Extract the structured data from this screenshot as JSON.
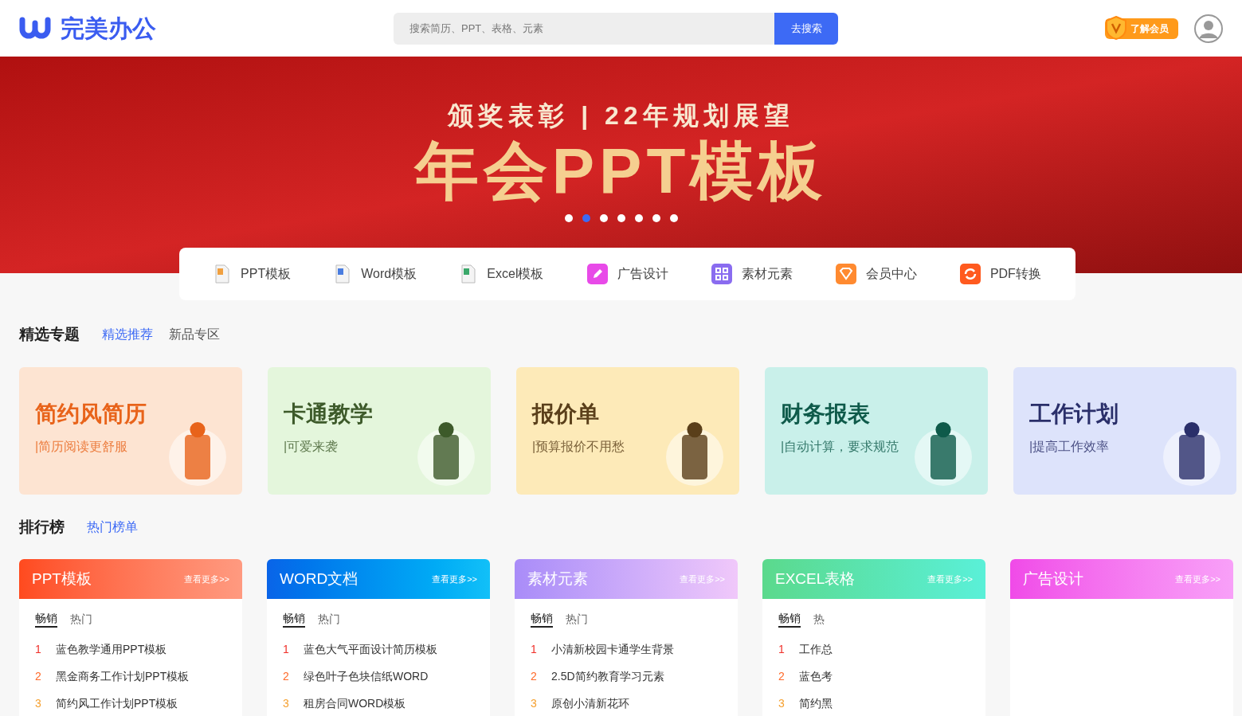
{
  "header": {
    "logo": "完美办公",
    "search": {
      "placeholder": "搜索简历、PPT、表格、元素",
      "button": "去搜索"
    },
    "vip": "了解会员"
  },
  "banner": {
    "subtitle": "颁奖表彰 | 22年规划展望",
    "title": "年会PPT模板",
    "dots": [
      {
        "selected": false
      },
      {
        "selected": true
      },
      {
        "selected": false
      },
      {
        "selected": false
      },
      {
        "selected": false
      },
      {
        "selected": false
      },
      {
        "selected": false
      }
    ]
  },
  "categories": [
    {
      "kind": "ppt",
      "label": "PPT模板"
    },
    {
      "kind": "word",
      "label": "Word模板"
    },
    {
      "kind": "excel",
      "label": "Excel模板"
    },
    {
      "kind": "ad",
      "label": "广告设计"
    },
    {
      "kind": "material",
      "label": "素材元素"
    },
    {
      "kind": "vip",
      "label": "会员中心"
    },
    {
      "kind": "pdf",
      "label": "PDF转换"
    }
  ],
  "featured": {
    "title": "精选专题",
    "tabs": [
      {
        "label": "精选推荐",
        "selected": true
      },
      {
        "label": "新品专区",
        "selected": false
      }
    ],
    "cards": [
      {
        "title": "简约风简历",
        "subtitle": "|简历阅读更舒服",
        "color": "#e8631a"
      },
      {
        "title": "卡通教学",
        "subtitle": "|可爱来袭",
        "color": "#3d5a2a"
      },
      {
        "title": "报价单",
        "subtitle": "|预算报价不用愁",
        "color": "#5a3f1a"
      },
      {
        "title": "财务报表",
        "subtitle": "|自动计算，要求规范",
        "color": "#0e5a4a"
      },
      {
        "title": "工作计划",
        "subtitle": "|提高工作效率",
        "color": "#2a2f6a"
      }
    ]
  },
  "ranking": {
    "title": "排行榜",
    "tabs": [
      {
        "label": "热门榜单",
        "selected": true
      }
    ],
    "boards": [
      {
        "title": "PPT模板",
        "more": "查看更多>>",
        "tabs": [
          {
            "label": "畅销",
            "selected": true
          },
          {
            "label": "热门",
            "selected": false
          }
        ],
        "items": [
          {
            "rank": "1",
            "name": "蓝色教学通用PPT模板"
          },
          {
            "rank": "2",
            "name": "黑金商务工作计划PPT模板"
          },
          {
            "rank": "3",
            "name": "简约风工作计划PPT模板"
          }
        ]
      },
      {
        "title": "WORD文档",
        "more": "查看更多>>",
        "tabs": [
          {
            "label": "畅销",
            "selected": true
          },
          {
            "label": "热门",
            "selected": false
          }
        ],
        "items": [
          {
            "rank": "1",
            "name": "蓝色大气平面设计简历模板"
          },
          {
            "rank": "2",
            "name": "绿色叶子色块信纸WORD"
          },
          {
            "rank": "3",
            "name": "租房合同WORD模板"
          }
        ]
      },
      {
        "title": "素材元素",
        "more": "查看更多>>",
        "tabs": [
          {
            "label": "畅销",
            "selected": true
          },
          {
            "label": "热门",
            "selected": false
          }
        ],
        "items": [
          {
            "rank": "1",
            "name": "小清新校园卡通学生背景"
          },
          {
            "rank": "2",
            "name": "2.5D简约教育学习元素"
          },
          {
            "rank": "3",
            "name": "原创小清新花环"
          }
        ]
      },
      {
        "title": "EXCEL表格",
        "more": "查看更多>>",
        "tabs": [
          {
            "label": "畅销",
            "selected": true
          },
          {
            "label": "热",
            "selected": false
          }
        ],
        "items": [
          {
            "rank": "1",
            "name": "工作总"
          },
          {
            "rank": "2",
            "name": "蓝色考"
          },
          {
            "rank": "3",
            "name": "简约黑"
          }
        ]
      },
      {
        "title": "广告设计",
        "more": "查看更多>>"
      }
    ]
  }
}
